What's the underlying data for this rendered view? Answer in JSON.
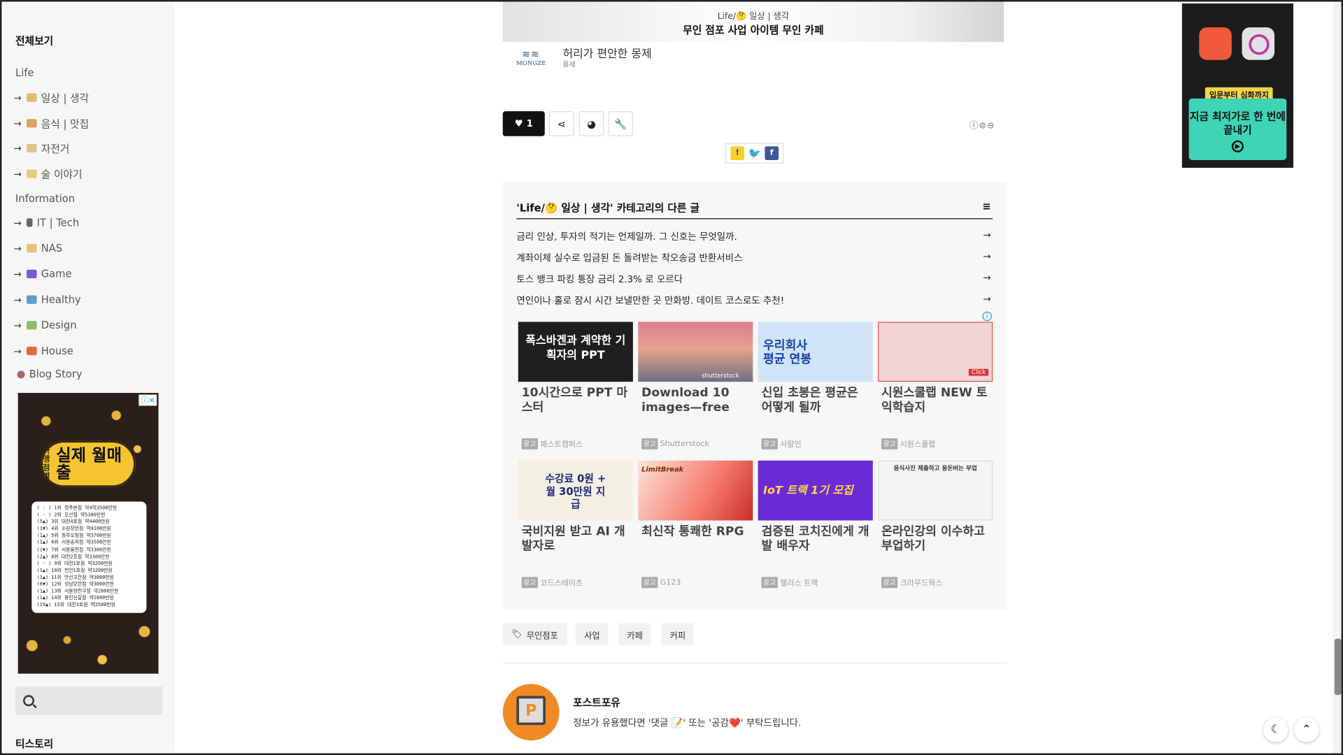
{
  "sidebar": {
    "title": "전체보기",
    "groups": [
      {
        "label": "Life"
      },
      {
        "label": "Information"
      }
    ],
    "items": [
      {
        "label": "일상 | 생각",
        "color": "#e8b86d"
      },
      {
        "label": "음식 | 맛집",
        "color": "#d9a35a"
      },
      {
        "label": "자전거",
        "color": "#e0c38a"
      },
      {
        "label": "술 이야기",
        "color": "#e9c97a"
      },
      {
        "label": "IT | Tech",
        "color": "#666666"
      },
      {
        "label": "NAS",
        "color": "#e6c27a"
      },
      {
        "label": "Game",
        "color": "#7a5ad0"
      },
      {
        "label": "Healthy",
        "color": "#5aa0c8"
      },
      {
        "label": "Design",
        "color": "#8cbf6a"
      },
      {
        "label": "House",
        "color": "#e06a4a"
      },
      {
        "label": "Blog Story",
        "color": "#a66666"
      }
    ],
    "ad": {
      "bubble_small": "가맹점별",
      "bubble_big": "실제 월매출",
      "rows": [
        "( - )  1위  청주본점     약4억3500만원",
        "( - )  2위  오산점       약5300만원",
        "(5▲)  3위  대전4호점    약4400만원",
        "(1▼)  4위  수원장안점   약4100만원",
        "(1▲)  5위  청주오창점   약3700만원",
        "(1▲)  6위  서울송파점   약3500만원",
        "(1▼)  7위  서울봉천점   약3300만원",
        "(2▲)  8위  대전2호점    약3300만원",
        "( - )  9위  대전1호점    약3200만원",
        "(1▲) 10위  천안1호점    약3200만원",
        "(1▲) 11위  안산고잔점   약3000만원",
        "(6▼) 12위  성남모란점   약3000만원",
        "(1▲) 13위  서울양천구점 약2800만원",
        "(1▲) 14위  용인신갈점   약2800만원",
        "(19▲) 15위  대전3호점   약2500만원"
      ]
    },
    "footer_title": "티스토리"
  },
  "post": {
    "top_category": "Life/🤔 일상 | 생각",
    "top_title": "무인 점포 사업 아이템 무인 카페",
    "ad_logo": "MONGZE",
    "ad_title": "허리가 편안한 몽제",
    "ad_brand": "몽제",
    "like_count": "1",
    "cc_icons": "ⓘ⊜⊝"
  },
  "related": {
    "heading": "'Life/🤔 일상 | 생각' 카테고리의 다른 글",
    "items": [
      "금리 인상, 투자의 적기는 언제일까. 그 신호는 무엇일까.",
      "계좌이체 실수로 입금된 돈 돌려받는 착오송금 반환서비스",
      "토스 뱅크 파킹 통장 금리 2.3% 로 오르다",
      "연인이나 홀로 잠시 시간 보낼만한 곳 만화방. 데이트 코스로도 추천!"
    ],
    "ad_tag": "광고",
    "cards": [
      {
        "title": "10시간으로 PPT 마스터",
        "source": "패스트캠퍼스",
        "img_text": "폭스바겐과 계약한 기획자의 PPT",
        "bg": "#1f1f1f"
      },
      {
        "title": "Download 10 images—free",
        "source": "Shutterstock",
        "img_text": "shutterstock",
        "bg": "#c8797c"
      },
      {
        "title": "신입 초봉은 평균은 어떻게 될까",
        "source": "사람인",
        "img_text": "우리회사 평균 연봉",
        "bg": "#cfe5f7"
      },
      {
        "title": "시원스쿨랩 NEW 토익학습지",
        "source": "시원스쿨랩",
        "img_text": "Click",
        "bg": "#f3d3d6"
      },
      {
        "title": "국비지원 받고 AI 개발자로",
        "source": "코드스테이츠",
        "img_text": "수강료 0원 + 월 30만원 지급",
        "bg": "#f3efe3"
      },
      {
        "title": "최신작 통쾌한 RPG",
        "source": "G123",
        "img_text": "LimitBreak",
        "bg": "#f6c7c0"
      },
      {
        "title": "검증된 코치진에게 개발 배우자",
        "source": "엘리스 트랙",
        "img_text": "IoT 트랙 1기 모집",
        "bg": "#6a2bd4"
      },
      {
        "title": "온라인강의 이수하고 부업하기",
        "source": "크라우드웍스",
        "img_text": "음식사진 제출하고 용돈버는 부업",
        "bg": "#f4f4f4"
      }
    ]
  },
  "tags": [
    "무인점포",
    "사업",
    "카페",
    "커피"
  ],
  "author": {
    "name": "포스트포유",
    "desc": "정보가 유용했다면 '댓글 📝' 또는 '공감❤️' 부탁드립니다."
  },
  "right_ad": {
    "pill": "입문부터 심화까지",
    "cta": "지금 최저가로 한 번에 끝내기"
  }
}
